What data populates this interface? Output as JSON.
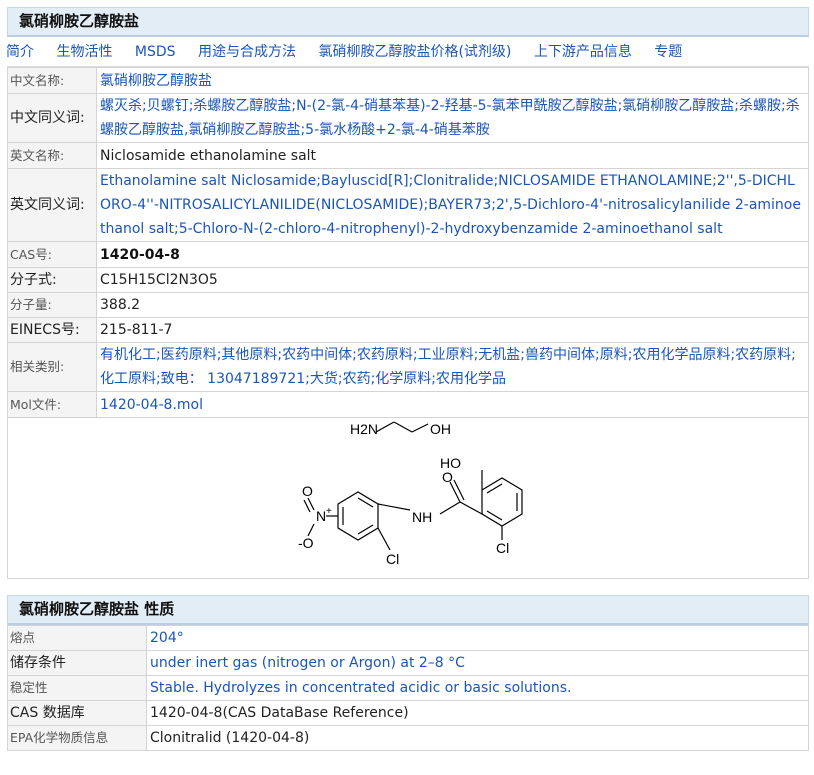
{
  "header": {
    "title": "氯硝柳胺乙醇胺盐"
  },
  "nav": [
    "简介",
    "生物活性",
    "MSDS",
    "用途与合成方法",
    "氯硝柳胺乙醇胺盐价格(试剂级)",
    "上下游产品信息",
    "专题"
  ],
  "rows": {
    "cn_name": {
      "label": "中文名称:",
      "value": "氯硝柳胺乙醇胺盐"
    },
    "cn_syn": {
      "label": "中文同义词:",
      "value": "螺灭杀;贝螺钉;杀螺胺乙醇胺盐;N-(2-氯-4-硝基苯基)-2-羟基-5-氯苯甲酰胺乙醇胺盐;氯硝柳胺乙醇胺盐;杀螺胺;杀螺胺乙醇胺盐,氯硝柳胺乙醇胺盐;5-氯水杨酸+2-氯-4-硝基苯胺"
    },
    "en_name": {
      "label": "英文名称:",
      "value": "Niclosamide ethanolamine salt"
    },
    "en_syn": {
      "label": "英文同义词:",
      "value": "Ethanolamine salt Niclosamide;Bayluscid[R];Clonitralide;NICLOSAMIDE ETHANOLAMINE;2'',5-DICHLORO-4''-NITROSALICYLANILIDE(NICLOSAMIDE);BAYER73;2',5-Dichloro-4'-nitrosalicylanilide 2-aminoethanol salt;5-Chloro-N-(2-chloro-4-nitrophenyl)-2-hydroxybenzamide 2-aminoethanol salt"
    },
    "cas": {
      "label": "CAS号:",
      "value": "1420-04-8"
    },
    "formula": {
      "label": "分子式:",
      "value": "C15H15Cl2N3O5"
    },
    "mw": {
      "label": "分子量:",
      "value": "388.2"
    },
    "einecs": {
      "label": "EINECS号:",
      "value": "215-811-7"
    },
    "category": {
      "label": "相关类别:",
      "value": "有机化工;医药原料;其他原料;农药中间体;农药原料;工业原料;无机盐;兽药中间体;原料;农用化学品原料;农药原料;化工原料;致电： 13047189721;大货;农药;化学原料;农用化学品"
    },
    "mol": {
      "label": "Mol文件:",
      "value": "1420-04-8.mol"
    }
  },
  "structure": {
    "labels": {
      "h2n": "H2N",
      "oh_top": "OH",
      "ho": "HO",
      "o": "O",
      "nh": "NH",
      "cl_right": "Cl",
      "cl_bottom": "Cl",
      "no2_n": "N",
      "no2_plus": "+",
      "no2_o_top": "O",
      "no2_o_minus": "-O"
    }
  },
  "properties": {
    "title": "氯硝柳胺乙醇胺盐 性质",
    "rows": [
      {
        "label": "熔点",
        "value": "204°"
      },
      {
        "label": "储存条件",
        "value": "under inert gas (nitrogen or Argon) at 2–8 °C"
      },
      {
        "label": "稳定性",
        "value": "Stable. Hydrolyzes in concentrated acidic or basic solutions."
      },
      {
        "label": "CAS 数据库",
        "value": "1420-04-8(CAS DataBase Reference)"
      },
      {
        "label": "EPA化学物质信息",
        "value": "Clonitralid (1420-04-8)"
      }
    ]
  },
  "colors": {
    "link": "#1a56b8",
    "header_bg": "#e3edf6",
    "label_bg": "#f4f4f4"
  }
}
